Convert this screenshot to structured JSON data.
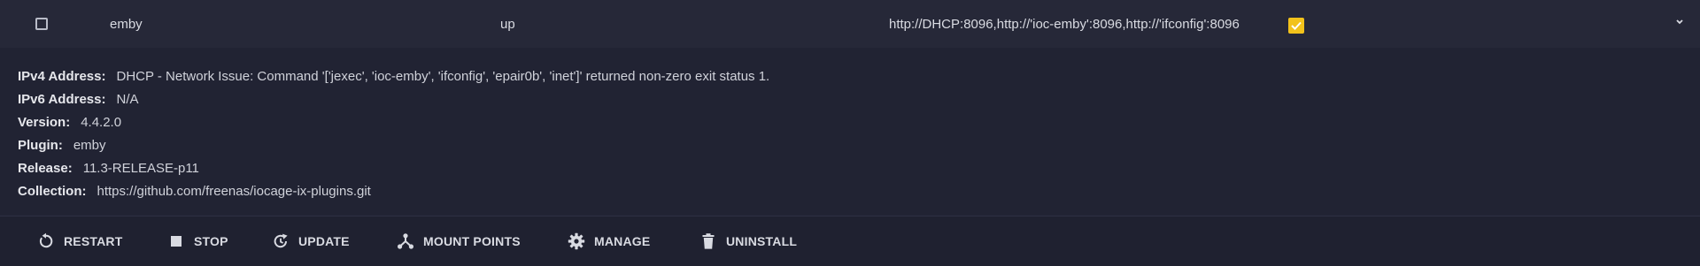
{
  "row": {
    "name": "emby",
    "status": "up",
    "ports": "http://DHCP:8096,http://'ioc-emby':8096,http://'ifconfig':8096",
    "boot_checked": true
  },
  "details": [
    {
      "label": "IPv4 Address:",
      "value": "DHCP - Network Issue: Command '['jexec', 'ioc-emby', 'ifconfig', 'epair0b', 'inet']' returned non-zero exit status 1."
    },
    {
      "label": "IPv6 Address:",
      "value": "N/A"
    },
    {
      "label": "Version:",
      "value": "4.4.2.0"
    },
    {
      "label": "Plugin:",
      "value": "emby"
    },
    {
      "label": "Release:",
      "value": "11.3-RELEASE-p11"
    },
    {
      "label": "Collection:",
      "value": "https://github.com/freenas/iocage-ix-plugins.git"
    }
  ],
  "actions": {
    "restart": "RESTART",
    "stop": "STOP",
    "update": "UPDATE",
    "mount_points": "MOUNT POINTS",
    "manage": "MANAGE",
    "uninstall": "UNINSTALL"
  },
  "icons": {
    "checkbox": "checkbox-empty-icon",
    "boot": "checkmark-icon",
    "expand": "chevron-down-icon",
    "restart": "restart-icon",
    "stop": "stop-icon",
    "update": "update-icon",
    "mount_points": "mount-points-icon",
    "manage": "gear-icon",
    "uninstall": "trash-icon"
  },
  "colors": {
    "accent": "#f2c21b",
    "background": "#222435"
  }
}
